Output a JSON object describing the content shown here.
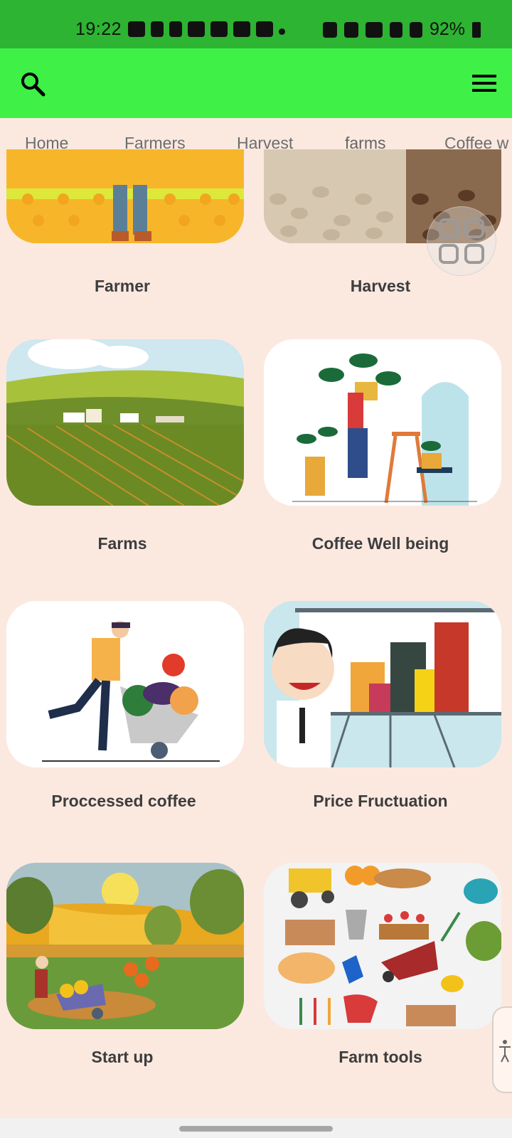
{
  "status_bar": {
    "time": "19:22",
    "battery": "92%"
  },
  "app_bar": {
    "search_icon": "search-icon",
    "menu_icon": "hamburger-menu-icon"
  },
  "tabs": [
    {
      "label": "Home"
    },
    {
      "label": "Farmers"
    },
    {
      "label": "Harvest"
    },
    {
      "label": "farms",
      "active": true
    },
    {
      "label": "Coffee w"
    }
  ],
  "cards": [
    {
      "label": "Farmer"
    },
    {
      "label": "Harvest"
    },
    {
      "label": "Farms"
    },
    {
      "label": "Coffee Well being"
    },
    {
      "label": "Proccessed coffee"
    },
    {
      "label": "Price Fructuation"
    },
    {
      "label": "Start up"
    },
    {
      "label": "Farm tools"
    }
  ]
}
